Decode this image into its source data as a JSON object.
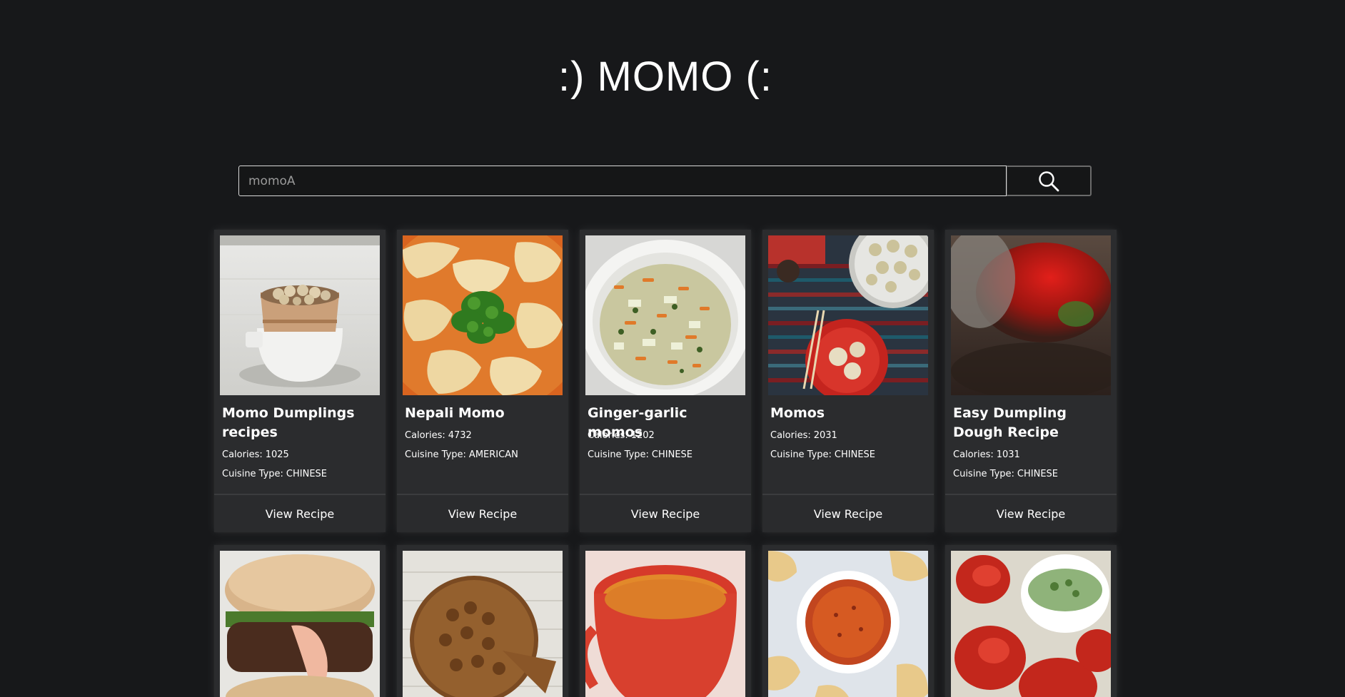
{
  "header": {
    "title": ":) MOMO (:"
  },
  "search": {
    "value": "momoA",
    "button_icon": "search-icon"
  },
  "labels": {
    "calories": "Calories:",
    "cuisine": "Cuisine Type:"
  },
  "recipes": [
    {
      "title": "Momo Dumplings recipes",
      "calories": "1025",
      "cuisine": "CHINESE",
      "button": "View Recipe",
      "image": "steamer-basket-dumplings"
    },
    {
      "title": "Nepali Momo",
      "calories": "4732",
      "cuisine": "AMERICAN",
      "button": "View Recipe",
      "image": "momo-soup-cilantro"
    },
    {
      "title": "Ginger-garlic momos",
      "calories": "1202",
      "cuisine": "CHINESE",
      "button": "View Recipe",
      "image": "vegetable-filling-bowl"
    },
    {
      "title": "Momos",
      "calories": "2031",
      "cuisine": "CHINESE",
      "button": "View Recipe",
      "image": "momos-red-plate-chopsticks"
    },
    {
      "title": "Easy Dumpling Dough Recipe",
      "calories": "1031",
      "cuisine": "CHINESE",
      "button": "View Recipe",
      "image": "red-peppers-blurred"
    }
  ],
  "recipes_row2": [
    {
      "image": "burger-with-sauce"
    },
    {
      "image": "round-flatbread-cake"
    },
    {
      "image": "red-cup-soup"
    },
    {
      "image": "dumplings-with-chutney"
    },
    {
      "image": "tomatoes-and-green-dip"
    }
  ]
}
